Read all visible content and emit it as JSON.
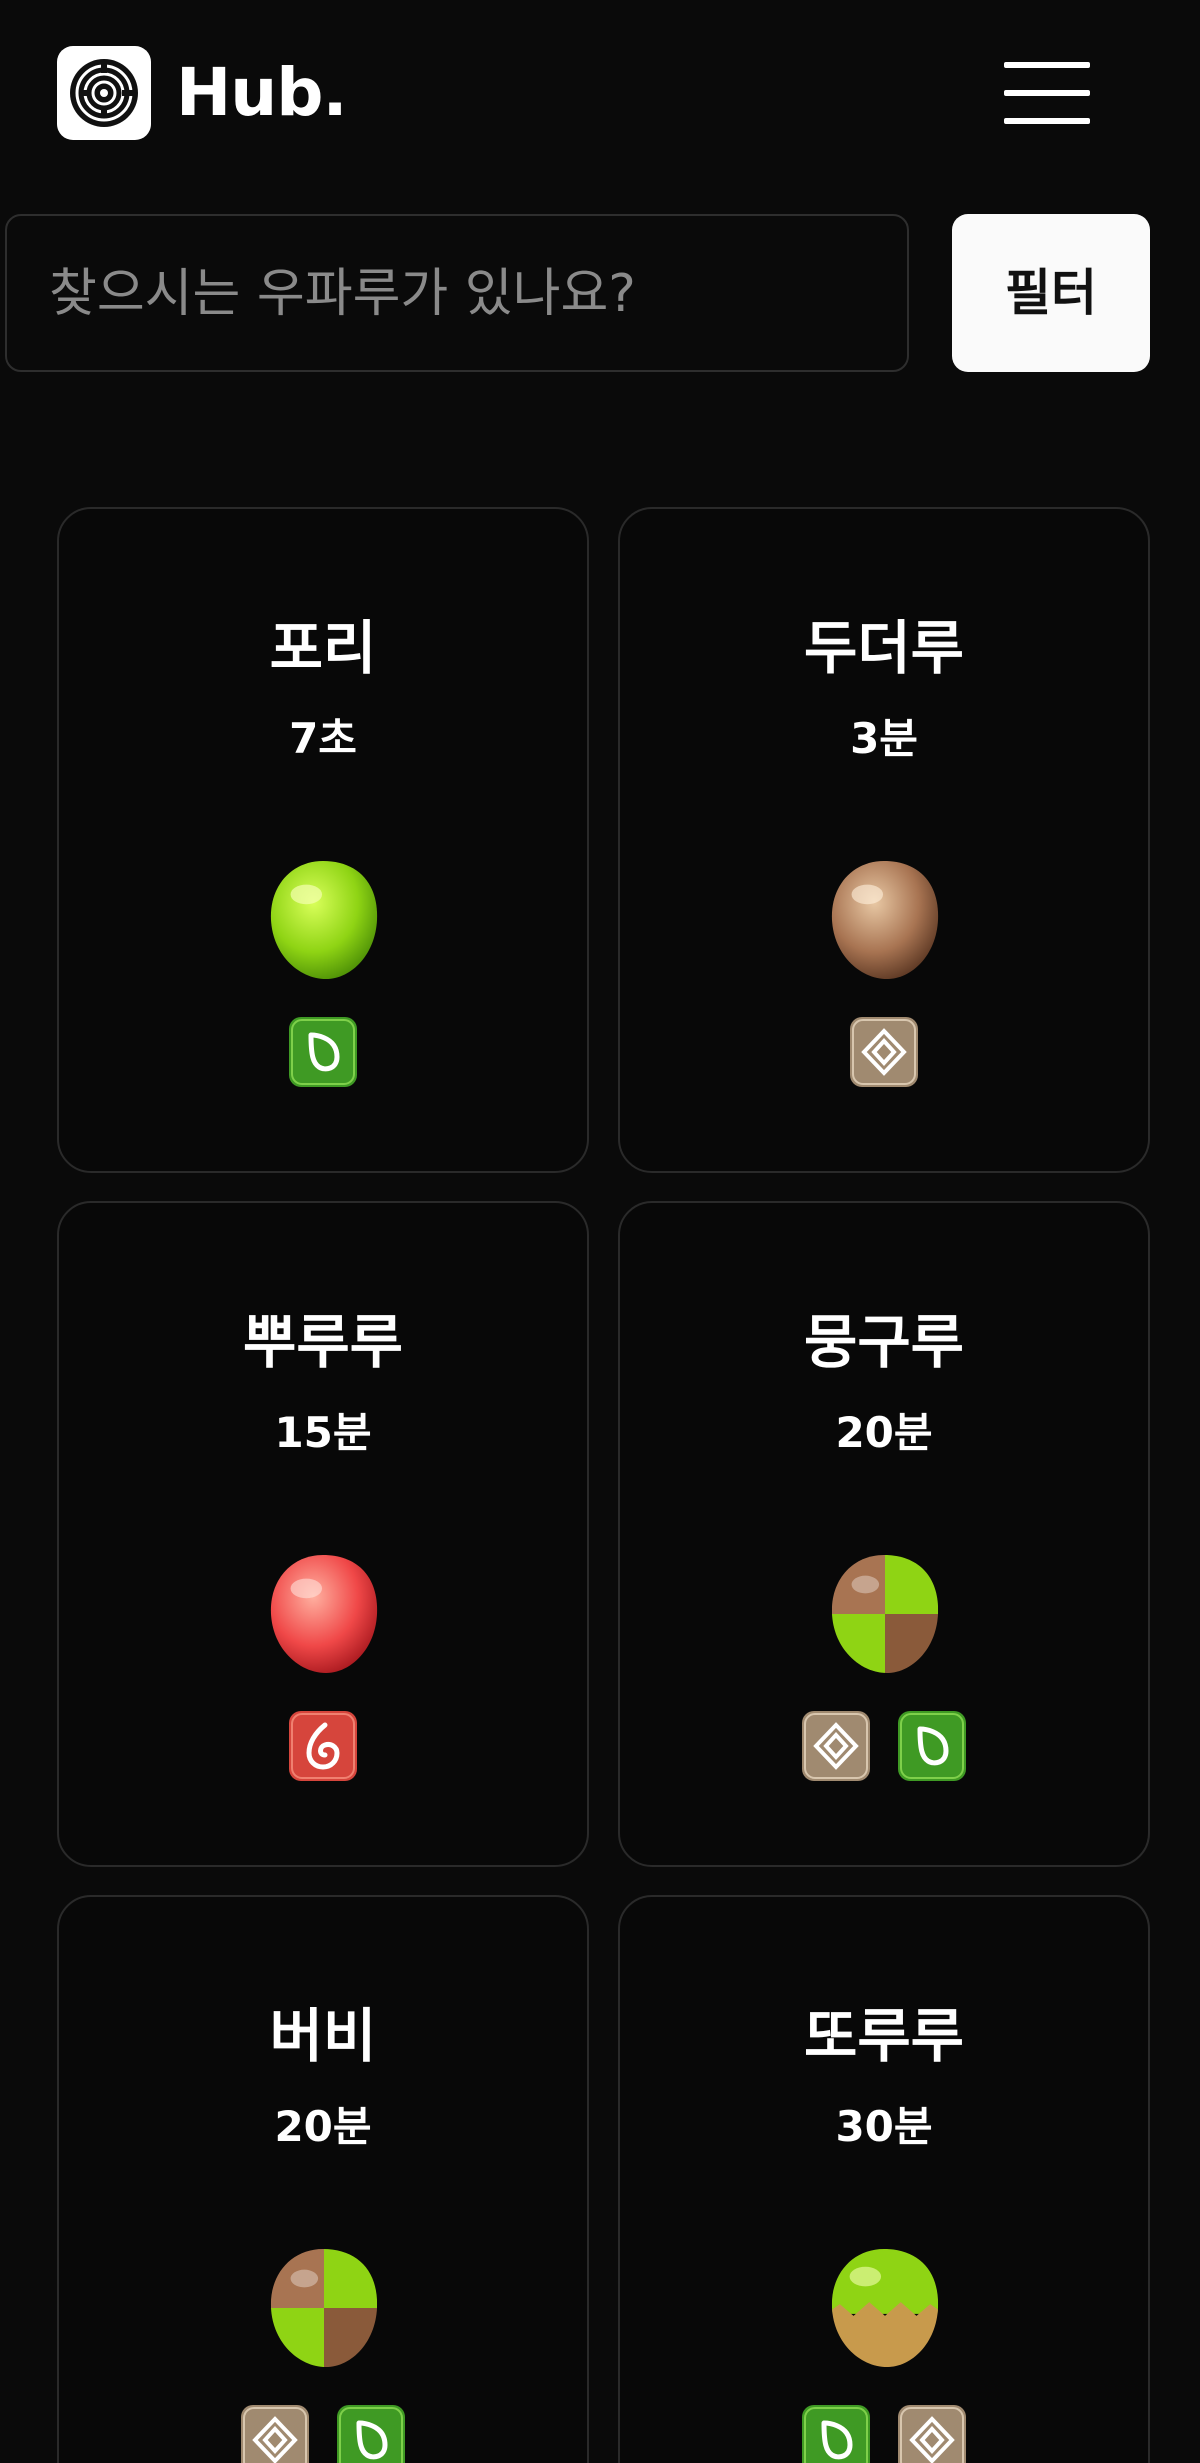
{
  "header": {
    "brand": "Hub.",
    "logo_icon": "maze-target-icon",
    "menu_icon": "hamburger-menu-icon"
  },
  "search": {
    "placeholder": "찾으시는 우파루가 있나요?",
    "value": ""
  },
  "filter": {
    "label": "필터"
  },
  "cards": [
    {
      "name": "포리",
      "time": "7초",
      "egg": "green",
      "badges": [
        "nature"
      ]
    },
    {
      "name": "두더루",
      "time": "3분",
      "egg": "brown",
      "badges": [
        "earth"
      ]
    },
    {
      "name": "뿌루루",
      "time": "15분",
      "egg": "red",
      "badges": [
        "fire"
      ]
    },
    {
      "name": "뭉구루",
      "time": "20분",
      "egg": "brown-green-quarters",
      "badges": [
        "earth",
        "nature"
      ]
    },
    {
      "name": "버비",
      "time": "20분",
      "egg": "brown-green-quarters",
      "badges": [
        "earth",
        "nature"
      ]
    },
    {
      "name": "또루루",
      "time": "30분",
      "egg": "green-gold-half",
      "badges": [
        "nature",
        "earth"
      ]
    }
  ],
  "colors": {
    "background": "#0a0a0a",
    "card_border": "#2a2a2a",
    "nature": "#3f9a24",
    "earth": "#a08a70",
    "fire": "#d6453c"
  }
}
